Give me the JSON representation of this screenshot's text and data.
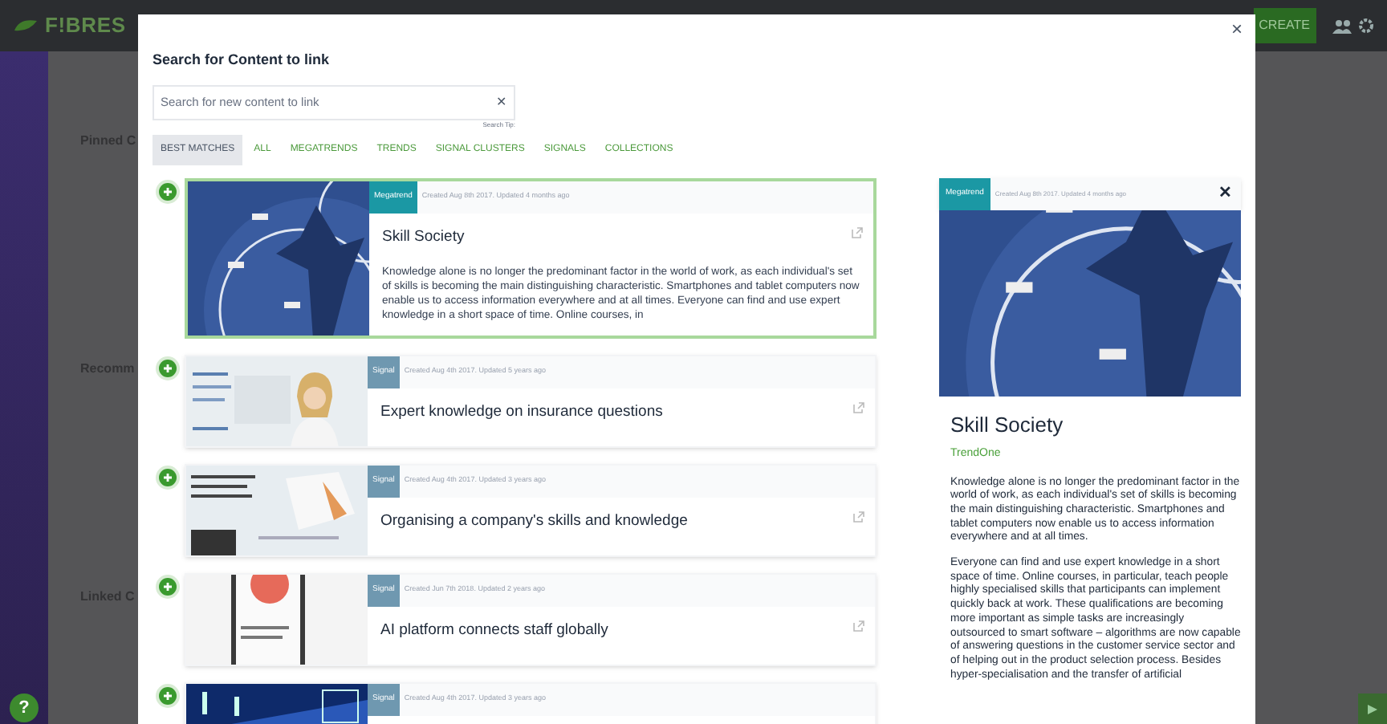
{
  "app": {
    "logo": "F!BRES",
    "create_button": "CREATE",
    "background_labels": [
      "Pinned C",
      "Recomm",
      "Linked C"
    ],
    "help_button": "?"
  },
  "modal": {
    "title": "Search for Content to link",
    "close": "×",
    "search": {
      "placeholder": "Search for new content to link",
      "clear": "✕",
      "tip": "Search Tip:"
    },
    "tabs": [
      {
        "label": "BEST MATCHES",
        "selected": true
      },
      {
        "label": "ALL",
        "selected": false
      },
      {
        "label": "MEGATRENDS",
        "selected": false
      },
      {
        "label": "TRENDS",
        "selected": false
      },
      {
        "label": "SIGNAL CLUSTERS",
        "selected": false
      },
      {
        "label": "SIGNALS",
        "selected": false
      },
      {
        "label": "COLLECTIONS",
        "selected": false
      }
    ],
    "results": [
      {
        "kind": "megatrend",
        "tag": "Megatrend",
        "meta": "Created Aug 8th 2017. Updated 4 months ago",
        "title": "Skill Society",
        "selected": true,
        "description": "Knowledge alone is no longer the predominant factor in the world of work, as each individual's set of skills is becoming the main distinguishing characteristic. Smartphones and tablet computers now enable us to access information everywhere and at all times. Everyone can find and use expert knowledge in a short space of time. Online courses, in"
      },
      {
        "kind": "signal",
        "tag": "Signal",
        "meta": "Created Aug 4th 2017. Updated 5 years ago",
        "title": "Expert knowledge on insurance questions",
        "selected": false
      },
      {
        "kind": "signal",
        "tag": "Signal",
        "meta": "Created Aug 4th 2017. Updated 3 years ago",
        "title": "Organising a company's skills and knowledge",
        "selected": false
      },
      {
        "kind": "signal",
        "tag": "Signal",
        "meta": "Created Jun 7th 2018. Updated 2 years ago",
        "title": "AI platform connects staff globally",
        "selected": false
      },
      {
        "kind": "signal",
        "tag": "Signal",
        "meta": "Created Aug 4th 2017. Updated 3 years ago",
        "selected": false
      }
    ],
    "preview": {
      "kind": "megatrend",
      "tag": "Megatrend",
      "meta": "Created Aug 8th 2017. Updated 4 months ago",
      "close": "✕",
      "title": "Skill Society",
      "source": "TrendOne",
      "paragraphs": [
        "Knowledge alone is no longer the predominant factor in the world of work, as each individual's set of skills is becoming the main distinguishing characteristic. Smartphones and tablet computers now enable us to access information everywhere and at all times.",
        "Everyone can find and use expert knowledge in a short space of time. Online courses, in particular, teach people highly specialised skills that participants can implement quickly back at work. These qualifications are becoming more important as simple tasks are increasingly outsourced to smart software – algorithms are now capable of answering questions in the customer service sector and of helping out in the product selection process. Besides hyper-specialisation and the transfer of artificial"
      ]
    }
  }
}
